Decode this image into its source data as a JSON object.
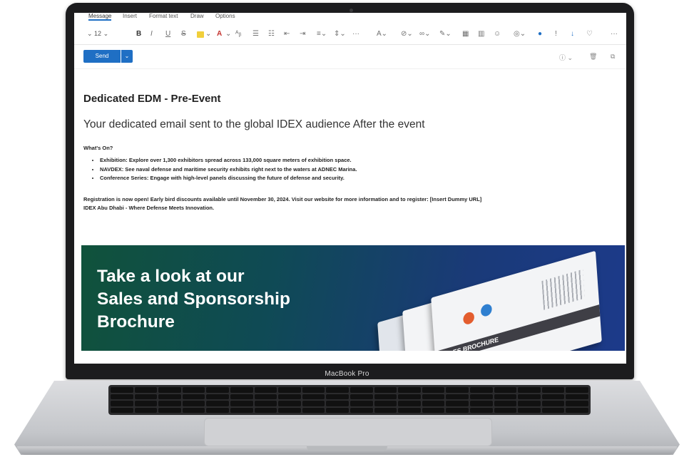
{
  "device": {
    "label": "MacBook Pro"
  },
  "ribbon": {
    "tabs": [
      {
        "label": "Message",
        "active": true
      },
      {
        "label": "Insert",
        "active": false
      },
      {
        "label": "Format text",
        "active": false
      },
      {
        "label": "Draw",
        "active": false
      },
      {
        "label": "Options",
        "active": false
      }
    ],
    "font_size": "12",
    "tools": {
      "bold": "B",
      "italic": "I",
      "underline": "U",
      "strikethrough": "S",
      "font_color": "A",
      "more": "···"
    },
    "icons": [
      "highlight-icon",
      "font-color-icon",
      "format-painter-icon",
      "bullets-icon",
      "numbering-icon",
      "decrease-indent-icon",
      "increase-indent-icon",
      "align-icon",
      "spacing-icon",
      "more-icon",
      "styles-icon",
      "attach-icon",
      "link-icon",
      "signature-icon",
      "table-icon",
      "chart-icon",
      "emoji-icon",
      "copilot-icon",
      "dictate-icon",
      "sensitivity-icon",
      "importance-icon",
      "immersive-reader-icon",
      "overflow-icon"
    ]
  },
  "sendbar": {
    "send_label": "Send",
    "icons": [
      "info-icon",
      "delete-icon",
      "popout-icon"
    ]
  },
  "email": {
    "heading": "Dedicated EDM - Pre-Event",
    "subheading": "Your dedicated email sent to the global IDEX audience After the event",
    "section_title": "What's On?",
    "bullets": [
      "Exhibition: Explore over 1,300 exhibitors spread across 133,000 square meters of exhibition space.",
      "NAVDEX: See naval defense and maritime security exhibits right next to the waters at ADNEC Marina.",
      "Conference Series: Engage with high-level panels discussing the future of defense and security."
    ],
    "registration": "Registration is now open! Early bird discounts available until November 30, 2024.     Visit our website for more information and to register: [Insert Dummy URL]",
    "tagline": "IDEX Abu Dhabi - Where Defense Meets Innovation."
  },
  "banner": {
    "line1": "Take a look at our",
    "line2": "Sales and Sponsorship",
    "line3": "Brochure",
    "brochure_label": "SALES BROCHURE",
    "colors": {
      "start": "#10523b",
      "end": "#1c3a8a"
    }
  },
  "colors": {
    "accent": "#1f6fc4",
    "frame": "#1c1c1e"
  }
}
